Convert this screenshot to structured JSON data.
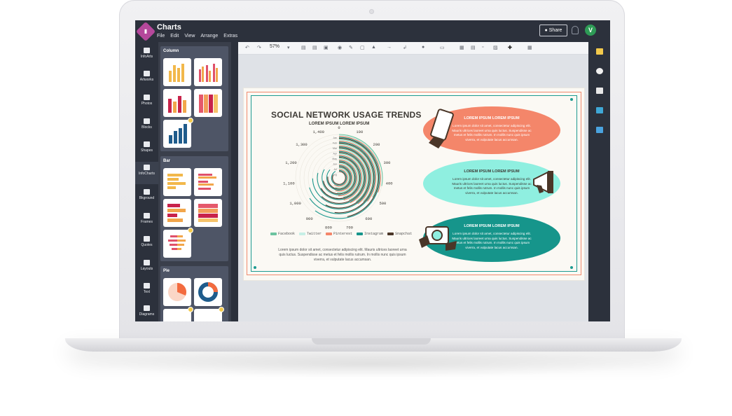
{
  "app": {
    "title": "Charts",
    "menu": [
      "File",
      "Edit",
      "View",
      "Arrange",
      "Extras"
    ],
    "share_label": "Share",
    "avatar_letter": "V",
    "logo_glyph": "▮"
  },
  "rail": {
    "items": [
      {
        "label": "InfoArts",
        "icon": "infoarts-icon"
      },
      {
        "label": "Artworks",
        "icon": "artworks-icon"
      },
      {
        "label": "Photos",
        "icon": "camera-icon"
      },
      {
        "label": "Blocks",
        "icon": "blocks-icon"
      },
      {
        "label": "Shapes",
        "icon": "shapes-icon"
      },
      {
        "label": "InfoCharts",
        "icon": "infocharts-icon"
      },
      {
        "label": "Bkground",
        "icon": "background-icon"
      },
      {
        "label": "Frames",
        "icon": "frames-icon"
      },
      {
        "label": "Quotes",
        "icon": "quotes-icon"
      },
      {
        "label": "Layouts",
        "icon": "layouts-icon"
      },
      {
        "label": "Text",
        "icon": "text-icon"
      },
      {
        "label": "Diagrams",
        "icon": "diagrams-icon"
      }
    ]
  },
  "panel": {
    "sections": [
      {
        "title": "Column"
      },
      {
        "title": "Bar"
      },
      {
        "title": "Pie"
      }
    ]
  },
  "toolbar": {
    "zoom": "57%"
  },
  "infographic": {
    "title": "SOCIAL NETWORK USAGE TRENDS",
    "subtitle": "LOREM IPSUM LOREM IPSUM",
    "paragraph": "Lorem ipsum dolor sit amet, consectetur adipiscing elit. Mauris ultrices laoreet urna quis luctus. Suspendisse ac metus et felis mollis rutrum. In mollis nunc quis ipsum viverra, et vulputate lacus accumsan.",
    "ellipse_title": "LOREM IPSUM LOREM IPSUM",
    "ellipse_body": "Lorem ipsum dolor sit amet, consectetur adipiscing elit. Mauris ultrices laoreet urna quis luctus. Suspendisse ac metus et felis mollis rutrum. In mollis nunc quis ipsum viverra, et vulputate lacus accumsan.",
    "colors": {
      "orange": "#f4866a",
      "mint": "#8fefe0",
      "teal": "#16958b",
      "dark": "#4a3628"
    }
  },
  "chart_data": {
    "type": "radial-bar",
    "title": "SOCIAL NETWORK USAGE TRENDS",
    "subtitle": "LOREM IPSUM LOREM IPSUM",
    "tick_labels": [
      "0",
      "100",
      "200",
      "300",
      "400",
      "500",
      "600",
      "700",
      "800",
      "900",
      "1,000",
      "1,100",
      "1,200",
      "1,300",
      "1,400"
    ],
    "range": [
      0,
      1500
    ],
    "categories": [
      "Jan",
      "Feb",
      "Mar",
      "Apr",
      "May",
      "Jun",
      "Jul",
      "Aug"
    ],
    "series": [
      {
        "name": "Facebook",
        "color": "#6cc3a0",
        "values": [
          420,
          500,
          560,
          600,
          650,
          700,
          780,
          840
        ]
      },
      {
        "name": "Twitter",
        "color": "#c6efe6",
        "values": [
          300,
          360,
          420,
          470,
          520,
          560,
          620,
          680
        ]
      },
      {
        "name": "Pinterest",
        "color": "#f4866a",
        "values": [
          460,
          540,
          600,
          650,
          700,
          760,
          820,
          900
        ]
      },
      {
        "name": "Instagram",
        "color": "#16958b",
        "values": [
          900,
          980,
          1050,
          1120,
          1180,
          1250,
          1300,
          1380
        ]
      },
      {
        "name": "Snapchat",
        "color": "#4a3628",
        "values": [
          700,
          780,
          860,
          930,
          1000,
          1080,
          1150,
          1230
        ]
      }
    ]
  }
}
